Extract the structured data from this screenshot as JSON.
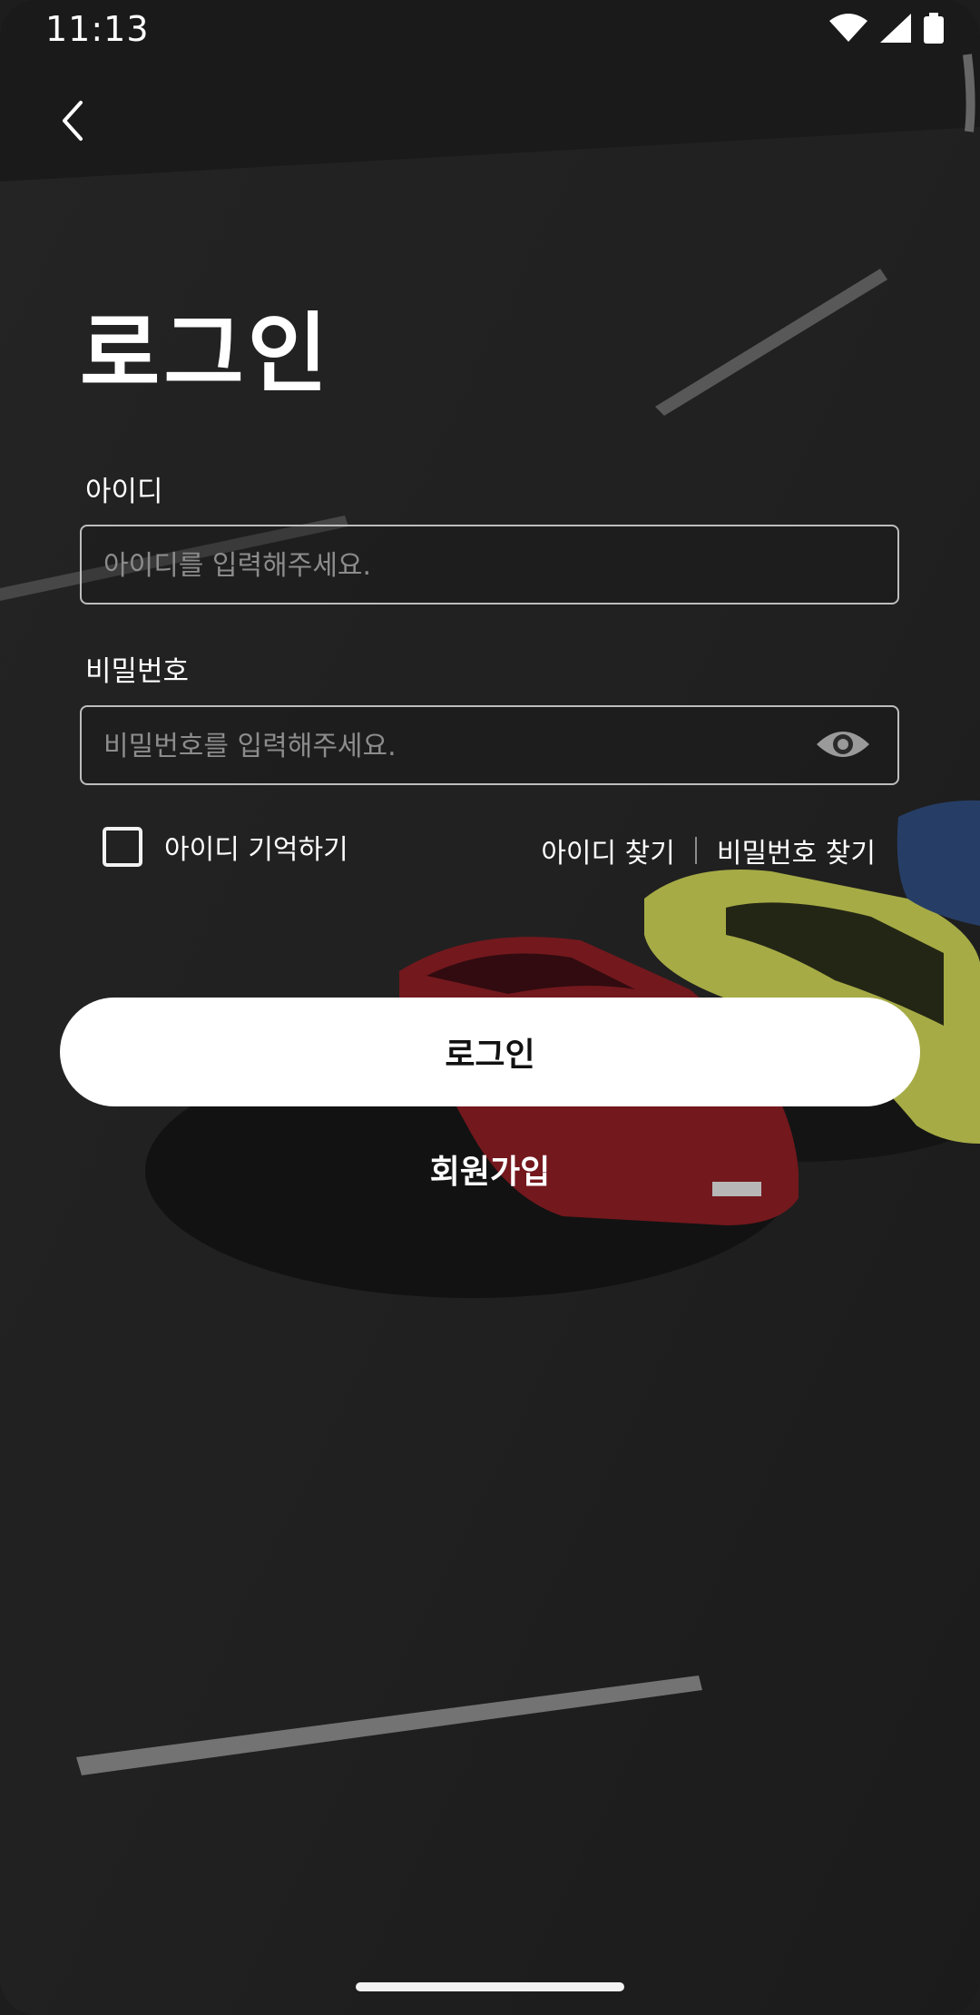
{
  "status_bar": {
    "time": "11:13",
    "icons": [
      "wifi-icon",
      "signal-icon",
      "battery-icon"
    ]
  },
  "nav": {
    "back_icon": "chevron-left-icon"
  },
  "title": "로그인",
  "id_field": {
    "label": "아이디",
    "placeholder": "아이디를 입력해주세요.",
    "value": ""
  },
  "password_field": {
    "label": "비밀번호",
    "placeholder": "비밀번호를 입력해주세요.",
    "value": "",
    "toggle_icon": "eye-icon"
  },
  "remember": {
    "label": "아이디 기억하기",
    "checked": false
  },
  "links": {
    "find_id": "아이디 찾기",
    "find_password": "비밀번호 찾기"
  },
  "buttons": {
    "login": "로그인",
    "signup": "회원가입"
  },
  "colors": {
    "background": "#222222",
    "text": "#ffffff",
    "button_bg": "#ffffff",
    "button_text": "#111111",
    "input_border": "#bdbdbd",
    "placeholder": "#8c8c8c"
  }
}
